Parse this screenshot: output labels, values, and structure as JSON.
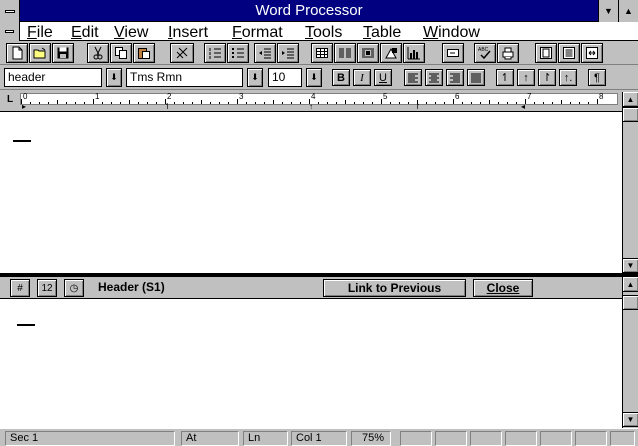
{
  "window": {
    "title": "Word Processor"
  },
  "menu": [
    "File",
    "Edit",
    "View",
    "Insert",
    "Format",
    "Tools",
    "Table",
    "Window"
  ],
  "toolbar": {
    "icons": [
      "new-document-icon",
      "open-folder-icon",
      "save-disk-icon",
      "cut-scissors-icon",
      "copy-icon",
      "paste-icon",
      "format-painter-icon",
      "numbered-list-icon",
      "bulleted-list-icon",
      "decrease-indent-icon",
      "increase-indent-icon",
      "insert-table-icon",
      "columns-icon",
      "insert-frame-icon",
      "drawing-icon",
      "chart-icon",
      "envelope-icon",
      "spell-check-icon",
      "print-icon",
      "zoom-whole-page-icon",
      "zoom-100-icon",
      "zoom-page-width-icon"
    ],
    "spell_label": "ABC"
  },
  "format": {
    "style": "header",
    "font": "Tms Rmn",
    "size": "10",
    "bold": "B",
    "italic": "I",
    "underline": "U",
    "pilcrow": "¶"
  },
  "ruler": {
    "corner": "L",
    "numbers": [
      "0",
      "1",
      "2",
      "3",
      "4",
      "5",
      "6",
      "7",
      "8"
    ]
  },
  "header_pane": {
    "label": "Header (S1)",
    "page_number_glyph": "#",
    "date_glyph": "12",
    "link_button": "Link to Previous",
    "close_button": "Close"
  },
  "status": {
    "section": "Sec 1",
    "at": "At",
    "line": "Ln",
    "column": "Col 1",
    "zoom": "75%"
  },
  "colors": {
    "title_bar": "#000080",
    "chrome": "#c0c0c0"
  }
}
